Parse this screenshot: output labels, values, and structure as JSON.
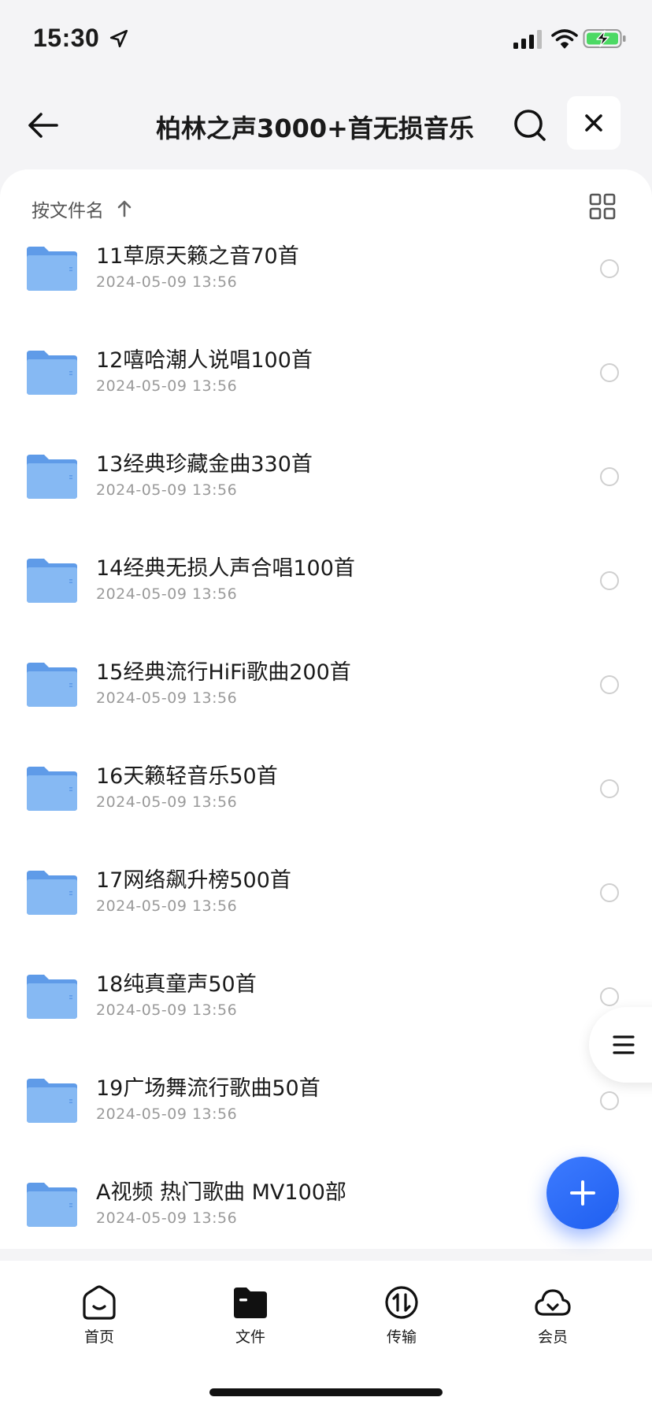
{
  "status_bar": {
    "time": "15:30"
  },
  "nav": {
    "title": "柏林之声3000+首无损音乐"
  },
  "sort": {
    "label": "按文件名"
  },
  "files": [
    {
      "name": "11草原天籁之音70首",
      "date": "2024-05-09 13:56"
    },
    {
      "name": "12嘻哈潮人说唱100首",
      "date": "2024-05-09 13:56"
    },
    {
      "name": "13经典珍藏金曲330首",
      "date": "2024-05-09 13:56"
    },
    {
      "name": "14经典无损人声合唱100首",
      "date": "2024-05-09 13:56"
    },
    {
      "name": "15经典流行HiFi歌曲200首",
      "date": "2024-05-09 13:56"
    },
    {
      "name": "16天籁轻音乐50首",
      "date": "2024-05-09 13:56"
    },
    {
      "name": "17网络飙升榜500首",
      "date": "2024-05-09 13:56"
    },
    {
      "name": "18纯真童声50首",
      "date": "2024-05-09 13:56"
    },
    {
      "name": "19广场舞流行歌曲50首",
      "date": "2024-05-09 13:56"
    },
    {
      "name": "A视频   热门歌曲   MV100部",
      "date": "2024-05-09 13:56"
    }
  ],
  "tabs": [
    {
      "label": "首页",
      "icon": "home-icon"
    },
    {
      "label": "文件",
      "icon": "file-icon"
    },
    {
      "label": "传输",
      "icon": "transfer-icon"
    },
    {
      "label": "会员",
      "icon": "cloud-icon"
    }
  ],
  "colors": {
    "accent": "#2563f5",
    "folder": "#6fa8ef",
    "background": "#f4f4f6"
  }
}
